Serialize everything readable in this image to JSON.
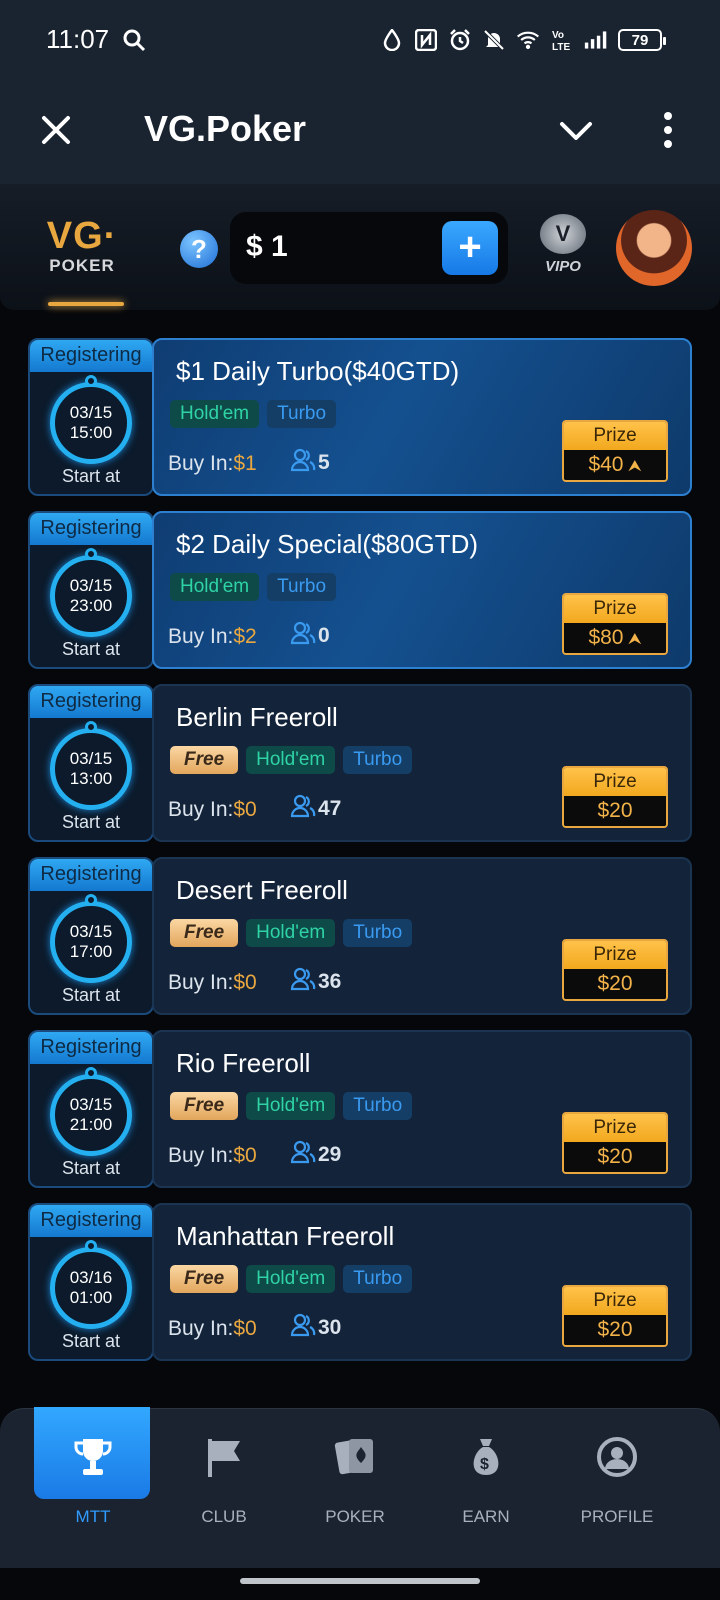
{
  "status_bar": {
    "time": "11:07",
    "battery": "79"
  },
  "app_bar": {
    "title": "VG.Poker"
  },
  "header": {
    "logo_vg": "VG·",
    "logo_poker": "POKER",
    "help": "?",
    "balance": "$ 1",
    "add": "+",
    "vip_badge": "V",
    "vip_label": "VIPO"
  },
  "tournaments": [
    {
      "status": "Registering",
      "date": "03/15",
      "time": "15:00",
      "start_label": "Start at",
      "title": "$1 Daily Turbo($40GTD)",
      "free": false,
      "tags": [
        "Hold'em",
        "Turbo"
      ],
      "buyin_label": "Buy In:",
      "buyin": "$1",
      "players": "5",
      "prize_label": "Prize",
      "prize": "$40",
      "highlight": true
    },
    {
      "status": "Registering",
      "date": "03/15",
      "time": "23:00",
      "start_label": "Start at",
      "title": "$2 Daily Special($80GTD)",
      "free": false,
      "tags": [
        "Hold'em",
        "Turbo"
      ],
      "buyin_label": "Buy In:",
      "buyin": "$2",
      "players": "0",
      "prize_label": "Prize",
      "prize": "$80",
      "highlight": true
    },
    {
      "status": "Registering",
      "date": "03/15",
      "time": "13:00",
      "start_label": "Start at",
      "title": "Berlin Freeroll",
      "free": true,
      "free_label": "Free",
      "tags": [
        "Hold'em",
        "Turbo"
      ],
      "buyin_label": "Buy In:",
      "buyin": "$0",
      "players": "47",
      "prize_label": "Prize",
      "prize": "$20",
      "highlight": false
    },
    {
      "status": "Registering",
      "date": "03/15",
      "time": "17:00",
      "start_label": "Start at",
      "title": "Desert Freeroll",
      "free": true,
      "free_label": "Free",
      "tags": [
        "Hold'em",
        "Turbo"
      ],
      "buyin_label": "Buy In:",
      "buyin": "$0",
      "players": "36",
      "prize_label": "Prize",
      "prize": "$20",
      "highlight": false
    },
    {
      "status": "Registering",
      "date": "03/15",
      "time": "21:00",
      "start_label": "Start at",
      "title": "Rio Freeroll",
      "free": true,
      "free_label": "Free",
      "tags": [
        "Hold'em",
        "Turbo"
      ],
      "buyin_label": "Buy In:",
      "buyin": "$0",
      "players": "29",
      "prize_label": "Prize",
      "prize": "$20",
      "highlight": false
    },
    {
      "status": "Registering",
      "date": "03/16",
      "time": "01:00",
      "start_label": "Start at",
      "title": "Manhattan Freeroll",
      "free": true,
      "free_label": "Free",
      "tags": [
        "Hold'em",
        "Turbo"
      ],
      "buyin_label": "Buy In:",
      "buyin": "$0",
      "players": "30",
      "prize_label": "Prize",
      "prize": "$20",
      "highlight": false
    }
  ],
  "bottom_nav": [
    {
      "label": "MTT",
      "icon": "trophy-icon",
      "active": true
    },
    {
      "label": "CLUB",
      "icon": "flag-icon",
      "active": false
    },
    {
      "label": "POKER",
      "icon": "cards-icon",
      "active": false
    },
    {
      "label": "EARN",
      "icon": "money-bag-icon",
      "active": false
    },
    {
      "label": "PROFILE",
      "icon": "profile-icon",
      "active": false
    }
  ]
}
